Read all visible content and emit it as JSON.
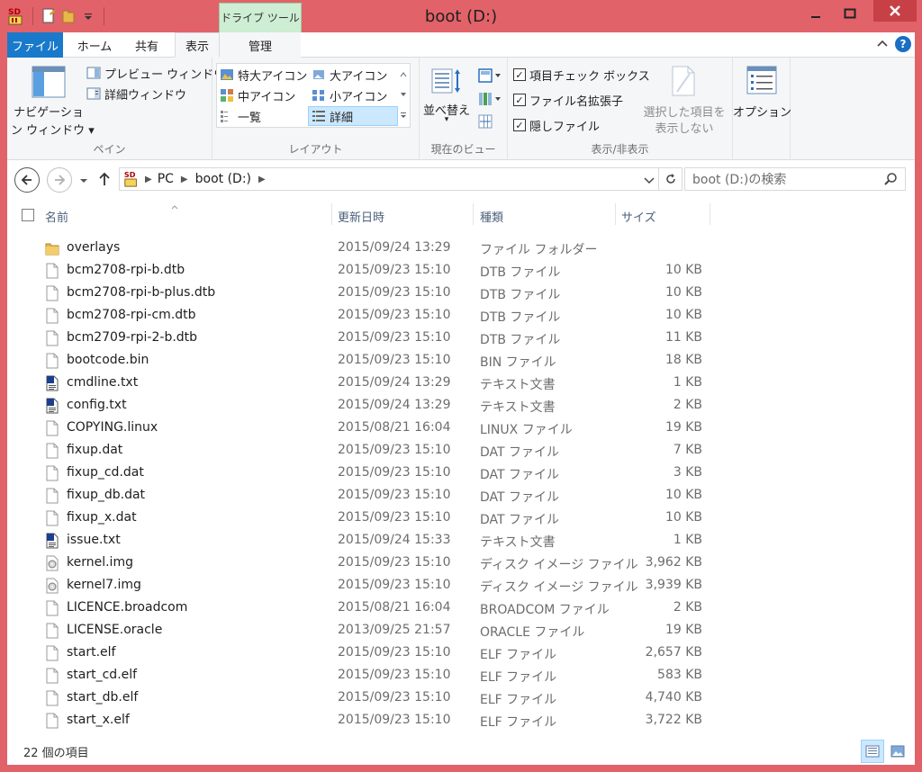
{
  "window": {
    "title": "boot (D:)",
    "contextual_tab": "ドライブ ツール"
  },
  "tabs": [
    {
      "label": "ファイル"
    },
    {
      "label": "ホーム"
    },
    {
      "label": "共有"
    },
    {
      "label": "表示"
    },
    {
      "label": "管理"
    }
  ],
  "ribbon": {
    "pane": {
      "nav_pane_line1": "ナビゲーショ",
      "nav_pane_line2": "ン ウィンドウ ▾",
      "preview_pane": "プレビュー ウィンドウ",
      "details_pane": "詳細ウィンドウ",
      "label": "ペイン"
    },
    "layout": {
      "items": [
        "特大アイコン",
        "大アイコン",
        "中アイコン",
        "小アイコン",
        "一覧",
        "詳細"
      ],
      "selected": "詳細",
      "label": "レイアウト"
    },
    "current_view": {
      "sort_line1": "並べ替え",
      "sort_line2": "▾",
      "label": "現在のビュー"
    },
    "show_hide": {
      "item_checkboxes": "項目チェック ボックス",
      "file_extensions": "ファイル名拡張子",
      "hidden_items": "隠しファイル",
      "hide_selected_line1": "選択した項目を",
      "hide_selected_line2": "表示しない",
      "label": "表示/非表示"
    },
    "options": {
      "label": "オプション"
    }
  },
  "address": {
    "crumbs": [
      "PC",
      "boot (D:)"
    ],
    "search_placeholder": "boot (D:)の検索"
  },
  "columns": {
    "name": "名前",
    "date": "更新日時",
    "type": "種類",
    "size": "サイズ"
  },
  "files": [
    {
      "name": "overlays",
      "date": "2015/09/24 13:29",
      "type": "ファイル フォルダー",
      "size": "",
      "icon": "folder"
    },
    {
      "name": "bcm2708-rpi-b.dtb",
      "date": "2015/09/23 15:10",
      "type": "DTB ファイル",
      "size": "10 KB",
      "icon": "file"
    },
    {
      "name": "bcm2708-rpi-b-plus.dtb",
      "date": "2015/09/23 15:10",
      "type": "DTB ファイル",
      "size": "10 KB",
      "icon": "file"
    },
    {
      "name": "bcm2708-rpi-cm.dtb",
      "date": "2015/09/23 15:10",
      "type": "DTB ファイル",
      "size": "10 KB",
      "icon": "file"
    },
    {
      "name": "bcm2709-rpi-2-b.dtb",
      "date": "2015/09/23 15:10",
      "type": "DTB ファイル",
      "size": "11 KB",
      "icon": "file"
    },
    {
      "name": "bootcode.bin",
      "date": "2015/09/23 15:10",
      "type": "BIN ファイル",
      "size": "18 KB",
      "icon": "file"
    },
    {
      "name": "cmdline.txt",
      "date": "2015/09/24 13:29",
      "type": "テキスト文書",
      "size": "1 KB",
      "icon": "text"
    },
    {
      "name": "config.txt",
      "date": "2015/09/24 13:29",
      "type": "テキスト文書",
      "size": "2 KB",
      "icon": "text"
    },
    {
      "name": "COPYING.linux",
      "date": "2015/08/21 16:04",
      "type": "LINUX ファイル",
      "size": "19 KB",
      "icon": "file"
    },
    {
      "name": "fixup.dat",
      "date": "2015/09/23 15:10",
      "type": "DAT ファイル",
      "size": "7 KB",
      "icon": "file"
    },
    {
      "name": "fixup_cd.dat",
      "date": "2015/09/23 15:10",
      "type": "DAT ファイル",
      "size": "3 KB",
      "icon": "file"
    },
    {
      "name": "fixup_db.dat",
      "date": "2015/09/23 15:10",
      "type": "DAT ファイル",
      "size": "10 KB",
      "icon": "file"
    },
    {
      "name": "fixup_x.dat",
      "date": "2015/09/23 15:10",
      "type": "DAT ファイル",
      "size": "10 KB",
      "icon": "file"
    },
    {
      "name": "issue.txt",
      "date": "2015/09/24 15:33",
      "type": "テキスト文書",
      "size": "1 KB",
      "icon": "text"
    },
    {
      "name": "kernel.img",
      "date": "2015/09/23 15:10",
      "type": "ディスク イメージ ファイル",
      "size": "3,962 KB",
      "icon": "disc"
    },
    {
      "name": "kernel7.img",
      "date": "2015/09/23 15:10",
      "type": "ディスク イメージ ファイル",
      "size": "3,939 KB",
      "icon": "disc"
    },
    {
      "name": "LICENCE.broadcom",
      "date": "2015/08/21 16:04",
      "type": "BROADCOM ファイル",
      "size": "2 KB",
      "icon": "file"
    },
    {
      "name": "LICENSE.oracle",
      "date": "2013/09/25 21:57",
      "type": "ORACLE ファイル",
      "size": "19 KB",
      "icon": "file"
    },
    {
      "name": "start.elf",
      "date": "2015/09/23 15:10",
      "type": "ELF ファイル",
      "size": "2,657 KB",
      "icon": "file"
    },
    {
      "name": "start_cd.elf",
      "date": "2015/09/23 15:10",
      "type": "ELF ファイル",
      "size": "583 KB",
      "icon": "file"
    },
    {
      "name": "start_db.elf",
      "date": "2015/09/23 15:10",
      "type": "ELF ファイル",
      "size": "4,740 KB",
      "icon": "file"
    },
    {
      "name": "start_x.elf",
      "date": "2015/09/23 15:10",
      "type": "ELF ファイル",
      "size": "3,722 KB",
      "icon": "file"
    }
  ],
  "status": {
    "item_count": "22 個の項目"
  },
  "colors": {
    "frame": "#e2626a",
    "file_tab": "#1979ca",
    "selection": "#cce8ff"
  }
}
